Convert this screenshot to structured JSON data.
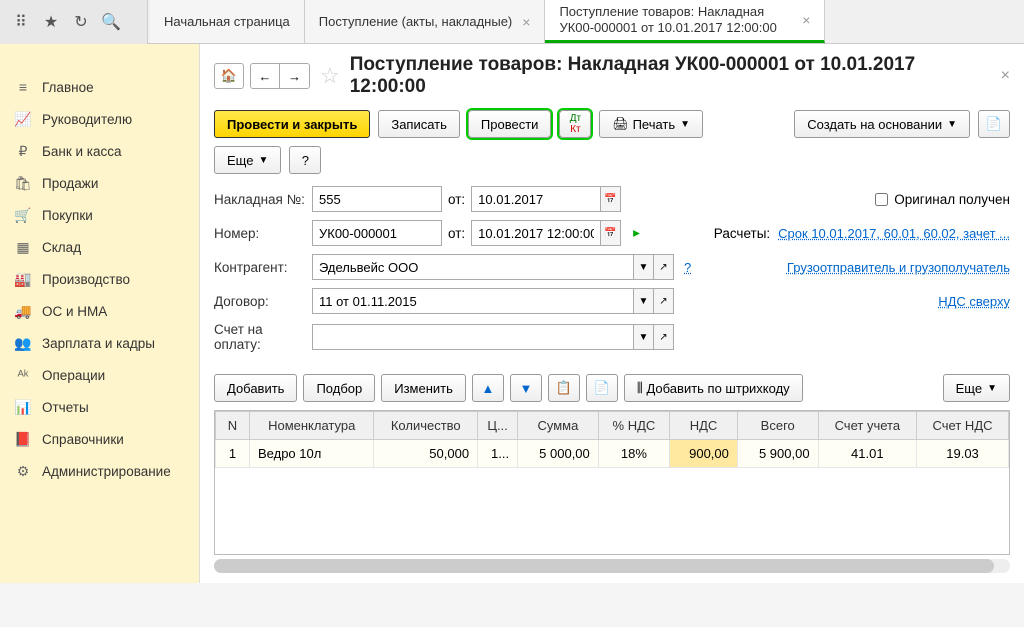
{
  "topStrip": {
    "icons": [
      "apps-icon",
      "star-icon",
      "history-icon",
      "search-icon"
    ]
  },
  "tabs": [
    {
      "label": "Начальная страница",
      "closable": false
    },
    {
      "label": "Поступление (акты, накладные)",
      "closable": true
    },
    {
      "label": "Поступление товаров: Накладная УК00-000001 от 10.01.2017 12:00:00",
      "closable": true,
      "active": true
    }
  ],
  "sidebar": [
    {
      "label": "Главное",
      "icon": "≡"
    },
    {
      "label": "Руководителю",
      "icon": "📈"
    },
    {
      "label": "Банк и касса",
      "icon": "₽"
    },
    {
      "label": "Продажи",
      "icon": "🛍"
    },
    {
      "label": "Покупки",
      "icon": "🛒"
    },
    {
      "label": "Склад",
      "icon": "▦"
    },
    {
      "label": "Производство",
      "icon": "🏭"
    },
    {
      "label": "ОС и НМА",
      "icon": "🚚"
    },
    {
      "label": "Зарплата и кадры",
      "icon": "👥"
    },
    {
      "label": "Операции",
      "icon": "ᴬᵏ"
    },
    {
      "label": "Отчеты",
      "icon": "📊"
    },
    {
      "label": "Справочники",
      "icon": "📕"
    },
    {
      "label": "Администрирование",
      "icon": "⚙"
    }
  ],
  "document": {
    "title": "Поступление товаров: Накладная УК00-000001 от 10.01.2017 12:00:00"
  },
  "actions": {
    "postClose": "Провести и закрыть",
    "write": "Записать",
    "post": "Провести",
    "print": "Печать",
    "createBased": "Создать на основании",
    "more": "Еще",
    "help": "?"
  },
  "form": {
    "invoiceNoLabel": "Накладная №:",
    "invoiceNo": "555",
    "fromLabel": "от:",
    "invoiceDate": "10.01.2017",
    "originalReceived": "Оригинал получен",
    "numberLabel": "Номер:",
    "number": "УК00-000001",
    "dateTime": "10.01.2017 12:00:00",
    "settlementsLabel": "Расчеты:",
    "settlementsLink": "Срок 10.01.2017, 60.01, 60.02, зачет ...",
    "counterpartyLabel": "Контрагент:",
    "counterparty": "Эдельвейс ООО",
    "shipperLink": "Грузоотправитель и грузополучатель",
    "contractLabel": "Договор:",
    "contract": "11 от 01.11.2015",
    "vatLink": "НДС сверху",
    "invoiceForPaymentLabel": "Счет на оплату:",
    "invoiceForPayment": ""
  },
  "tableToolbar": {
    "add": "Добавить",
    "select": "Подбор",
    "change": "Изменить",
    "addByBarcode": "Добавить по штрихкоду",
    "more": "Еще"
  },
  "table": {
    "headers": [
      "N",
      "Номенклатура",
      "Количество",
      "Ц...",
      "Сумма",
      "% НДС",
      "НДС",
      "Всего",
      "Счет учета",
      "Счет НДС"
    ],
    "rows": [
      {
        "n": "1",
        "nomen": "Ведро 10л",
        "qty": "50,000",
        "price": "1...",
        "sum": "5 000,00",
        "vatPct": "18%",
        "vat": "900,00",
        "total": "5 900,00",
        "acct": "41.01",
        "vatAcct": "19.03"
      }
    ]
  }
}
